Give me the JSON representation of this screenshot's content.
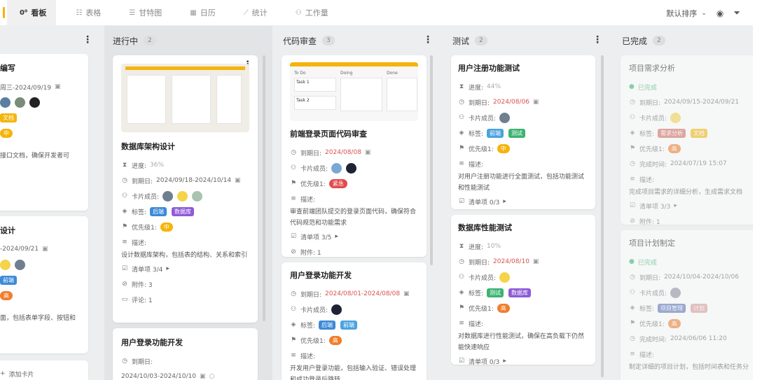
{
  "tabs": [
    {
      "label": "看板",
      "icon": "board-icon",
      "active": true
    },
    {
      "label": "表格",
      "icon": "table-icon"
    },
    {
      "label": "甘特图",
      "icon": "gantt-icon"
    },
    {
      "label": "日历",
      "icon": "calendar-icon"
    },
    {
      "label": "统计",
      "icon": "chart-icon"
    },
    {
      "label": "工作量",
      "icon": "workload-icon"
    }
  ],
  "tools": {
    "sort_label": "默认排序"
  },
  "columns": {
    "todo": {
      "cards": [
        {
          "title": "编写",
          "date": "周三-2024/09/19",
          "tag": "文档",
          "priority": "中",
          "desc": "接口文档，确保开发者可"
        },
        {
          "title": "设计",
          "date": "-2024/09/21",
          "tag": "前端",
          "priority": "高",
          "desc": "面，包括表单字段、按钮和"
        }
      ],
      "add_card": "添加卡片"
    },
    "progress": {
      "name": "进行中",
      "count": "2",
      "card1": {
        "title": "数据库架构设计",
        "progress_label": "进度:",
        "progress": "36%",
        "date_label": "到期日:",
        "date": "2024/09/18-2024/10/14",
        "members_label": "卡片成员:",
        "tags_label": "标签:",
        "tags": [
          "后端",
          "数据库"
        ],
        "priority_label": "优先级1:",
        "priority": "中",
        "desc_label": "描述:",
        "desc": "设计数据库架构，包括表的结构、关系和索引",
        "checklist": "清单项 3/4",
        "attach": "附件:  3",
        "comment": "评论:  1"
      },
      "card2": {
        "title": "用户登录功能开发",
        "date_label": "到期日:",
        "date": "2024/10/03-2024/10/10"
      }
    },
    "review": {
      "name": "代码审查",
      "count": "3",
      "card1": {
        "title": "前端登录页面代码审查",
        "date_label": "到期日:",
        "date": "2024/08/08",
        "members_label": "卡片成员:",
        "priority_label": "优先级1:",
        "priority": "紧急",
        "desc_label": "描述:",
        "desc": "审查前端团队提交的登录页面代码，确保符合代码规范和功能需求",
        "checklist": "清单项 3/5",
        "attach": "附件:  1",
        "thumb_cols": [
          "To Do",
          "Doing",
          "Done"
        ],
        "thumb_tasks": [
          "Task 1",
          "Task 2"
        ]
      },
      "card2": {
        "title": "用户登录功能开发",
        "date_label": "到期日:",
        "date": "2024/08/01-2024/08/08",
        "members_label": "卡片成员:",
        "tags_label": "标签:",
        "tags": [
          "后端",
          "前端"
        ],
        "priority_label": "优先级1:",
        "priority": "高",
        "desc_label": "描述:",
        "desc": "开发用户登录功能，包括输入验证、错误处理和成功登录后跳转。"
      }
    },
    "test": {
      "name": "测试",
      "count": "2",
      "card1": {
        "title": "用户注册功能测试",
        "progress_label": "进度:",
        "progress": "44%",
        "date_label": "到期日:",
        "date": "2024/08/06",
        "members_label": "卡片成员:",
        "tags_label": "标签:",
        "tags": [
          "前端",
          "测试"
        ],
        "priority_label": "优先级1:",
        "priority": "中",
        "desc_label": "描述:",
        "desc": "对用户注册功能进行全面测试，包括功能测试和性能测试",
        "checklist": "清单项 0/3"
      },
      "card2": {
        "title": "数据库性能测试",
        "progress_label": "进度:",
        "progress": "10%",
        "date_label": "到期日:",
        "date": "2024/08/10",
        "members_label": "卡片成员:",
        "tags_label": "标签:",
        "tags": [
          "测试",
          "数据库"
        ],
        "priority_label": "优先级1:",
        "priority": "高",
        "desc_label": "描述:",
        "desc": "对数据库进行性能测试，确保在高负载下仍然能快速响应",
        "checklist": "清单项 0/3"
      }
    },
    "done": {
      "name": "已完成",
      "count": "2",
      "card1": {
        "title": "项目需求分析",
        "status": "已完成",
        "date_label": "到期日:",
        "date": "2024/09/15-2024/09/21",
        "members_label": "卡片成员:",
        "tags_label": "标签:",
        "tags": [
          "需求分析",
          "文档"
        ],
        "priority_label": "优先级1:",
        "priority": "高",
        "finish_label": "完成时间:",
        "finish": "2024/07/19 15:07",
        "desc_label": "描述:",
        "desc": "完成项目需求的详细分析，生成需求文档",
        "checklist": "清单项 3/3",
        "attach": "附件:  1"
      },
      "card2": {
        "title": "项目计划制定",
        "status": "已完成",
        "date_label": "到期日:",
        "date": "2024/10/04-2024/10/06",
        "members_label": "卡片成员:",
        "tags_label": "标签:",
        "tags": [
          "项目管理",
          "计划"
        ],
        "priority_label": "优先级1:",
        "priority": "高",
        "finish_label": "完成时间:",
        "finish": "2024/06/06 11:20",
        "desc_label": "描述:",
        "desc": "制定详细的项目计划，包括时间表和任务分"
      }
    }
  },
  "colors": {
    "accent": "#f5b40b",
    "board_bg": "#eceeef",
    "date_red": "#d9534f"
  }
}
